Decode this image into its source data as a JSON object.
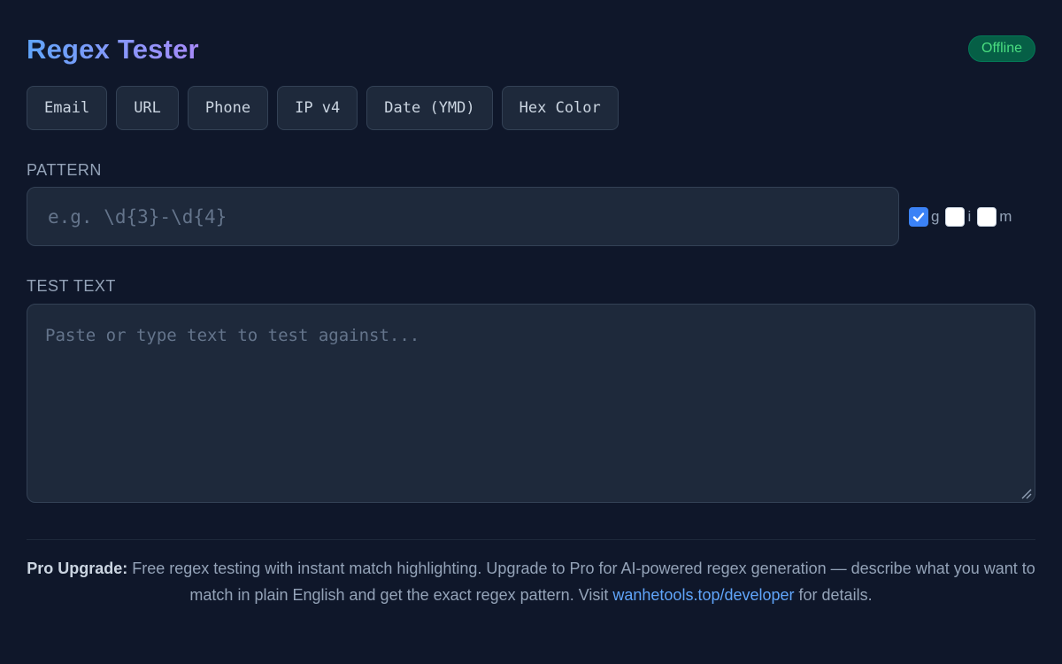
{
  "app": {
    "title": "Regex Tester",
    "status": "Offline"
  },
  "presets": [
    {
      "label": "Email"
    },
    {
      "label": "URL"
    },
    {
      "label": "Phone"
    },
    {
      "label": "IP v4"
    },
    {
      "label": "Date (YMD)"
    },
    {
      "label": "Hex Color"
    }
  ],
  "pattern": {
    "label": "PATTERN",
    "value": "",
    "placeholder": "e.g. \\d{3}-\\d{4}"
  },
  "flags": [
    {
      "label": "g",
      "checked": true
    },
    {
      "label": "i",
      "checked": false
    },
    {
      "label": "m",
      "checked": false
    }
  ],
  "test_text": {
    "label": "TEST TEXT",
    "value": "",
    "placeholder": "Paste or type text to test against..."
  },
  "footer": {
    "strong": "Pro Upgrade:",
    "text_before_link": " Free regex testing with instant match highlighting. Upgrade to Pro for AI-powered regex generation — describe what you want to match in plain English and get the exact regex pattern. Visit ",
    "link": "wanhetools.top/developer",
    "text_after_link": " for details."
  },
  "colors": {
    "background": "#0f172a",
    "panel": "#1e293b",
    "accent": "#3b82f6",
    "title_gradient_start": "#60a5fa",
    "title_gradient_end": "#a78bfa",
    "badge_bg": "#065f46",
    "badge_text": "#4ade80",
    "link": "#60a5fa"
  },
  "icons": {
    "checkmark": "checkmark-icon",
    "resize": "resize-grip-icon"
  }
}
